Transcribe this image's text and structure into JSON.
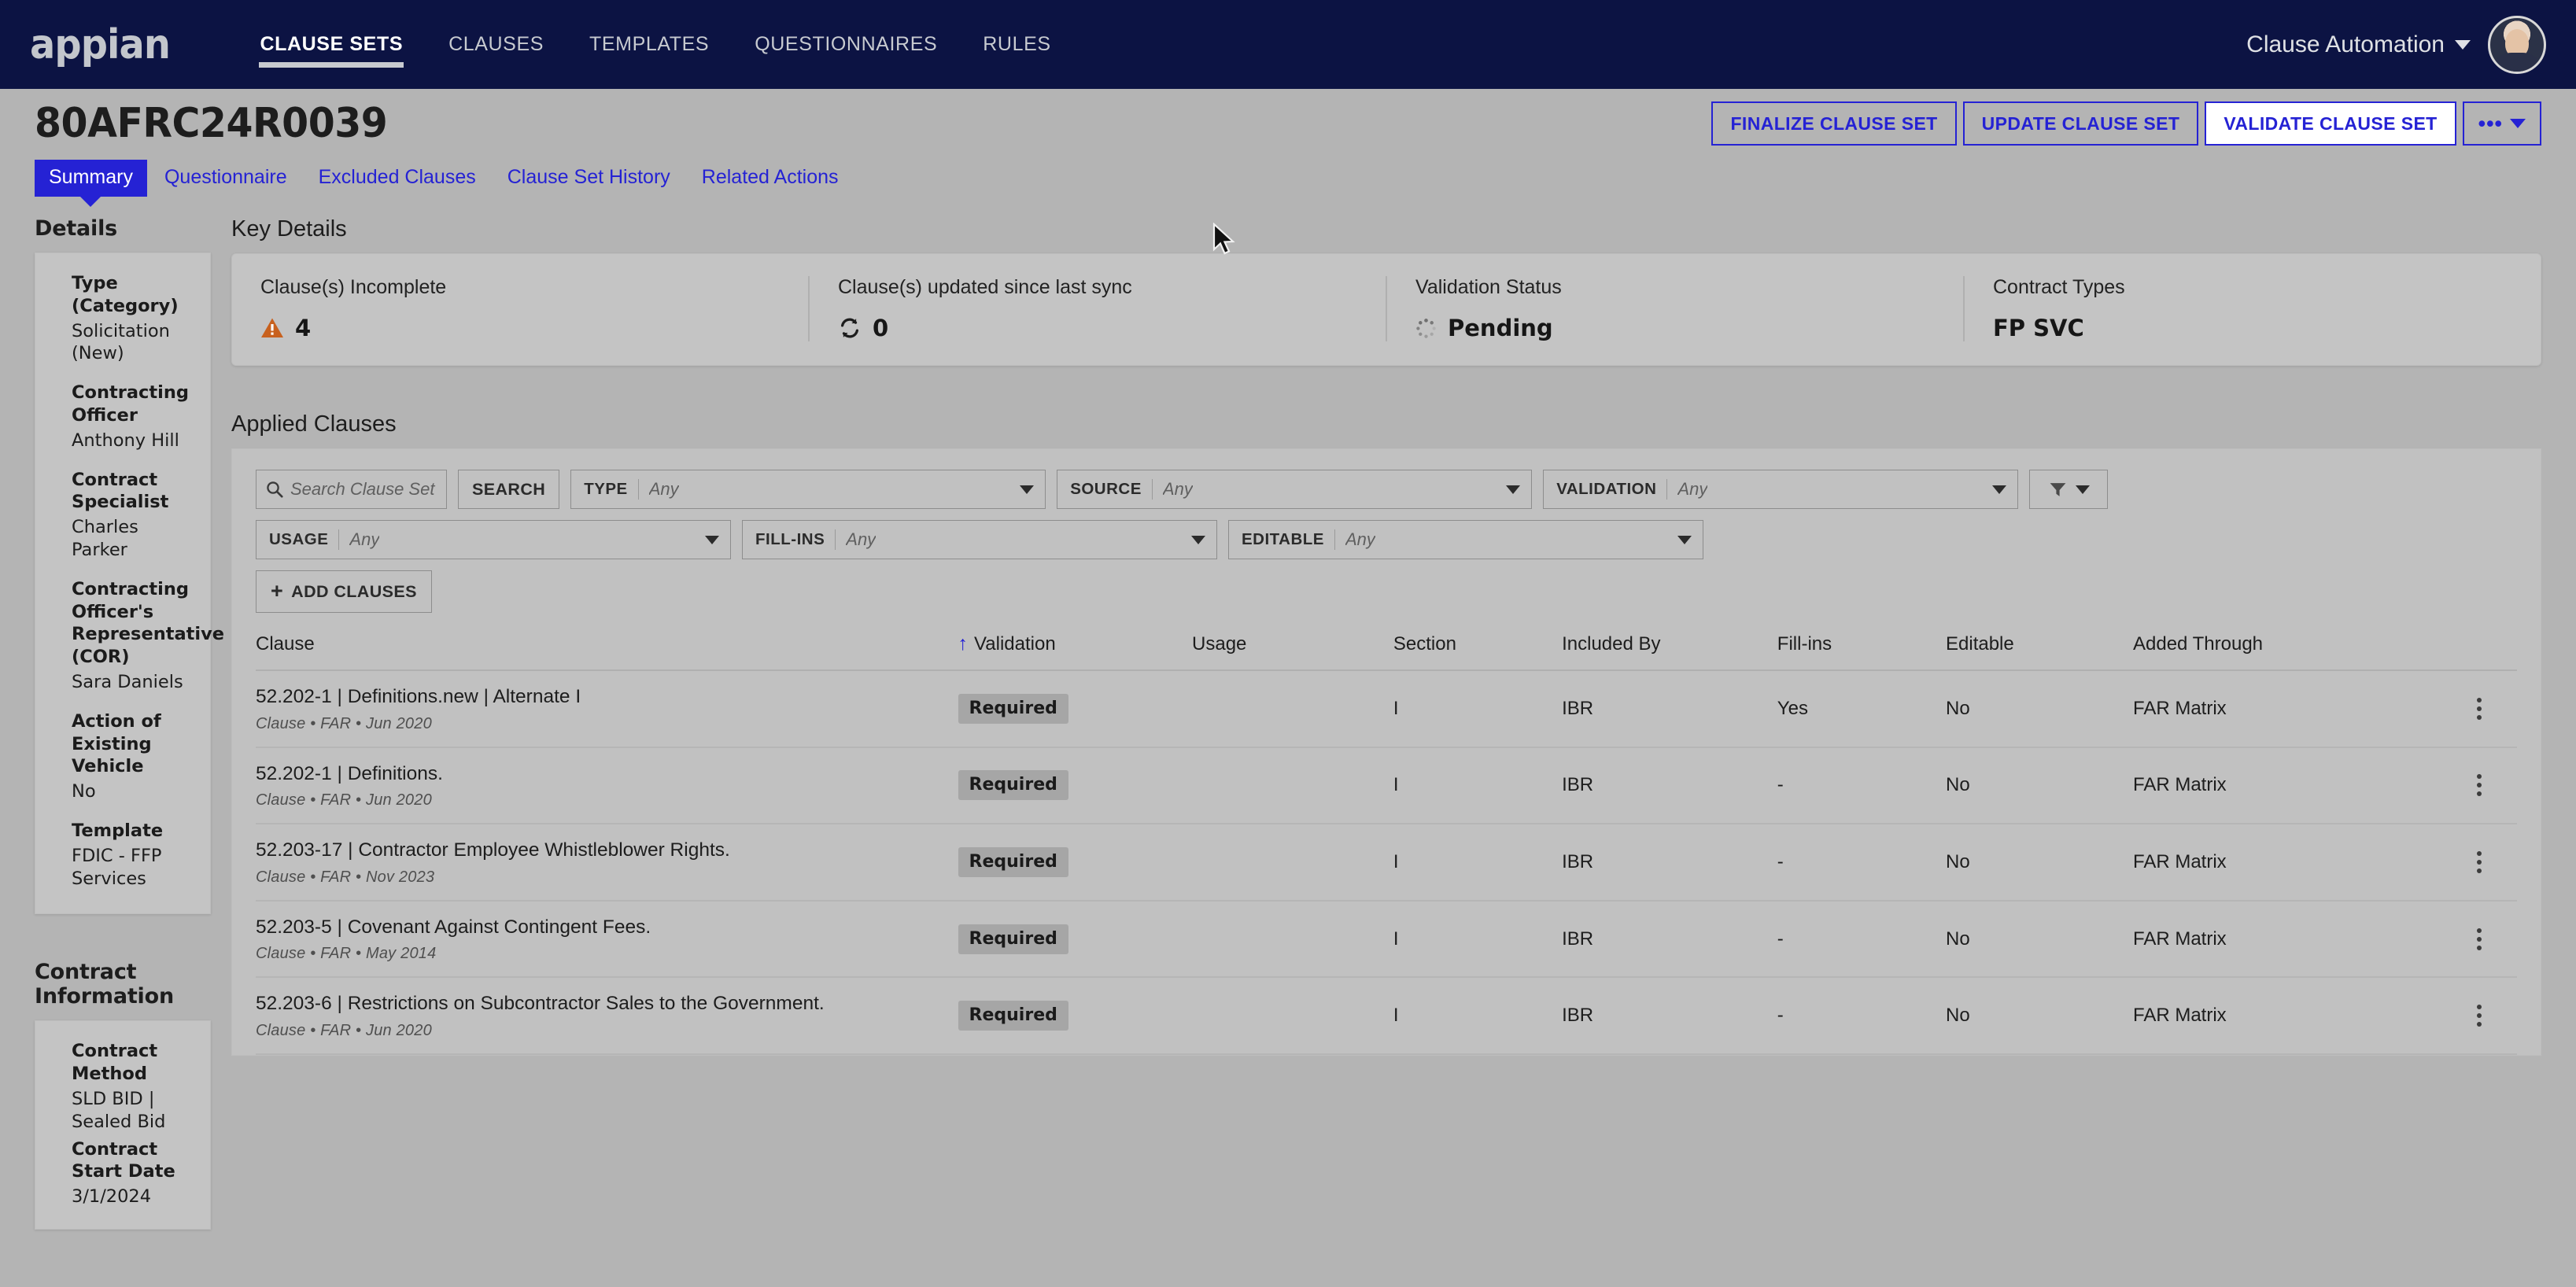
{
  "nav": {
    "brand": "appian",
    "links": [
      {
        "label": "CLAUSE SETS",
        "active": true
      },
      {
        "label": "CLAUSES",
        "active": false
      },
      {
        "label": "TEMPLATES",
        "active": false
      },
      {
        "label": "QUESTIONNAIRES",
        "active": false
      },
      {
        "label": "RULES",
        "active": false
      }
    ],
    "user_menu": "Clause Automation",
    "brand_color": "#0c1343",
    "accent_color": "#2522d4"
  },
  "page": {
    "title": "80AFRC24R0039",
    "actions": [
      {
        "label": "FINALIZE CLAUSE SET",
        "hover": false
      },
      {
        "label": "UPDATE CLAUSE SET",
        "hover": false
      },
      {
        "label": "VALIDATE CLAUSE SET",
        "hover": true
      }
    ],
    "overflow_label": "•••"
  },
  "tabs": [
    {
      "label": "Summary",
      "active": true
    },
    {
      "label": "Questionnaire",
      "active": false
    },
    {
      "label": "Excluded Clauses",
      "active": false
    },
    {
      "label": "Clause Set History",
      "active": false
    },
    {
      "label": "Related Actions",
      "active": false
    }
  ],
  "sidebar": {
    "details_heading": "Details",
    "details": [
      {
        "label": "Type (Category)",
        "value": "Solicitation (New)"
      },
      {
        "label": "Contracting Officer",
        "value": "Anthony Hill"
      },
      {
        "label": "Contract Specialist",
        "value": "Charles Parker"
      },
      {
        "label": "Contracting Officer's Representative (COR)",
        "value": "Sara Daniels"
      },
      {
        "label": "Action of Existing Vehicle",
        "value": "No"
      },
      {
        "label": "Template",
        "value": "FDIC - FFP Services"
      }
    ],
    "contract_heading": "Contract Information",
    "contract": [
      {
        "label": "Contract Method",
        "value": "SLD BID  |  Sealed Bid"
      },
      {
        "label": "Contract Start Date",
        "value": "3/1/2024"
      }
    ]
  },
  "key_details": {
    "heading": "Key Details",
    "cells": [
      {
        "title": "Clause(s) Incomplete",
        "value": "4",
        "icon": "warning-triangle-icon",
        "icon_color": "#c8611e"
      },
      {
        "title": "Clause(s) updated since last sync",
        "value": "0",
        "icon": "sync-icon",
        "icon_color": "#1d1d1d"
      },
      {
        "title": "Validation Status",
        "value": "Pending",
        "icon": "spinner-icon",
        "icon_color": "#6b6b6b"
      },
      {
        "title": "Contract Types",
        "value": "FP SVC",
        "icon": "",
        "icon_color": ""
      }
    ]
  },
  "applied_clauses": {
    "heading": "Applied Clauses",
    "search": {
      "placeholder": "Search Clause Set Clauses",
      "value": "",
      "button_label": "SEARCH"
    },
    "filters": [
      {
        "label": "TYPE",
        "value": "Any"
      },
      {
        "label": "SOURCE",
        "value": "Any"
      },
      {
        "label": "VALIDATION",
        "value": "Any"
      },
      {
        "label": "USAGE",
        "value": "Any"
      },
      {
        "label": "FILL-INS",
        "value": "Any"
      },
      {
        "label": "EDITABLE",
        "value": "Any"
      }
    ],
    "add_button": "ADD CLAUSES",
    "columns": [
      "Clause",
      "Validation",
      "Usage",
      "Section",
      "Included By",
      "Fill-ins",
      "Editable",
      "Added Through"
    ],
    "sorted_column": "Validation",
    "sort_direction": "asc",
    "rows": [
      {
        "clause": "52.202-1 | Definitions.new | Alternate I",
        "meta": "Clause • FAR • Jun 2020",
        "validation": "",
        "usage": "Required",
        "section": "I",
        "included_by": "IBR",
        "fill_ins": "Yes",
        "editable": "No",
        "added_through": "FAR Matrix"
      },
      {
        "clause": "52.202-1 | Definitions.",
        "meta": "Clause • FAR • Jun 2020",
        "validation": "",
        "usage": "Required",
        "section": "I",
        "included_by": "IBR",
        "fill_ins": "-",
        "editable": "No",
        "added_through": "FAR Matrix"
      },
      {
        "clause": "52.203-17 | Contractor Employee Whistleblower Rights.",
        "meta": "Clause • FAR • Nov 2023",
        "validation": "",
        "usage": "Required",
        "section": "I",
        "included_by": "IBR",
        "fill_ins": "-",
        "editable": "No",
        "added_through": "FAR Matrix"
      },
      {
        "clause": "52.203-5 | Covenant Against Contingent Fees.",
        "meta": "Clause • FAR • May 2014",
        "validation": "",
        "usage": "Required",
        "section": "I",
        "included_by": "IBR",
        "fill_ins": "-",
        "editable": "No",
        "added_through": "FAR Matrix"
      },
      {
        "clause": "52.203-6 | Restrictions on Subcontractor Sales to the Government.",
        "meta": "Clause • FAR • Jun 2020",
        "validation": "",
        "usage": "Required",
        "section": "I",
        "included_by": "IBR",
        "fill_ins": "-",
        "editable": "No",
        "added_through": "FAR Matrix"
      }
    ]
  }
}
